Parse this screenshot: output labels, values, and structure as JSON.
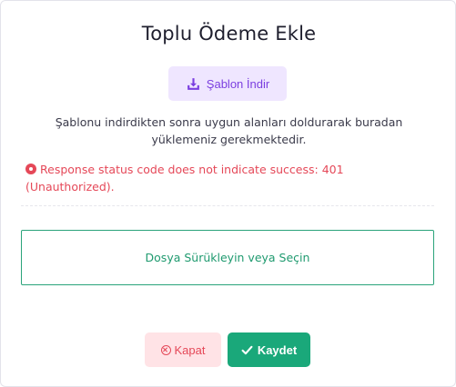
{
  "modal": {
    "title": "Toplu Ödeme Ekle",
    "template_button": {
      "label": "Şablon İndir",
      "icon": "download-icon",
      "color": "#7b3fe0",
      "background": "#efe6ff"
    },
    "description": "Şablonu indirdikten sonra uygun alanları doldurarak buradan yüklemeniz gerekmektedir.",
    "error": {
      "message": "Response status code does not indicate success: 401 (Unauthorized).",
      "icon": "error-circle-icon",
      "color": "#e54858"
    },
    "dropzone": {
      "label": "Dosya Sürükleyin veya Seçin",
      "color": "#1f9a6f"
    },
    "footer": {
      "close_button": {
        "label": "Kapat",
        "icon": "close-circle-icon",
        "color": "#e54858",
        "background": "#ffe3e6"
      },
      "save_button": {
        "label": "Kaydet",
        "icon": "check-icon",
        "background": "#1aa87a"
      }
    }
  }
}
